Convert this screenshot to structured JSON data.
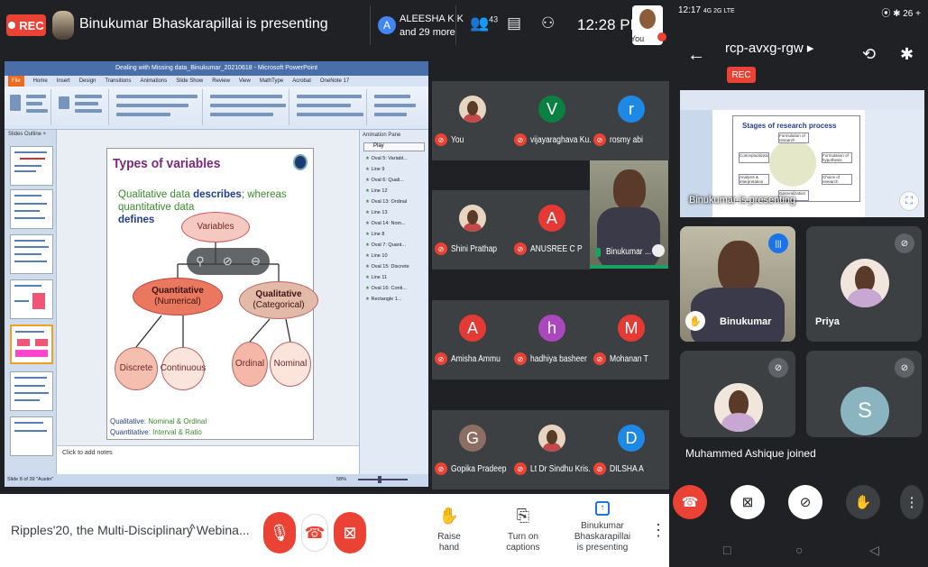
{
  "desktop": {
    "rec_label": "REC",
    "presenting_title": "Binukumar Bhaskarapillai is presenting",
    "presenter_avatar_letter": "A",
    "presenter_viewer_name": "ALEESHA K K",
    "viewer_count_text": "and 29 more",
    "people_count": "43",
    "time": "12:28 PM",
    "you_label": "You",
    "slide": {
      "app_title": "Dealing with Missing data_Binukumar_20210618 - Microsoft PowerPoint",
      "menu": [
        "File",
        "Home",
        "Insert",
        "Design",
        "Transitions",
        "Animations",
        "Slide Show",
        "Review",
        "View",
        "MathType",
        "Acrobat",
        "OneNote 17"
      ],
      "panel_tabs": "Slides   Outline   ×",
      "title": "Types of variables",
      "sub_green_1": "Qualitative data",
      "sub_blue_1": "describes",
      "sub_green_2": "; whereas quantitative data",
      "sub_blue_2": "defines",
      "node_variables": "Variables",
      "node_quant_1": "Quantitative",
      "node_quant_2": "(Numerical)",
      "node_qual_1": "Qualitative",
      "node_qual_2": "(Categorical)",
      "node_discrete": "Discrete",
      "node_continuous": "Continuous",
      "node_ordinal": "Ordinal",
      "node_nominal": "Nominal",
      "foot_1_label": "Qualitative",
      "foot_1_value": ": Nominal & Ordinal",
      "foot_2_label": "Quantitative",
      "foot_2_value": ": Interval & Ratio",
      "notes": "Click to add notes",
      "anim_header": "Animation Pane",
      "anim_play": "Play",
      "anim_items": [
        "Oval 5: Variabl...",
        "Line 9",
        "Oval 6: Quali...",
        "Line 12",
        "Oval 13: Ordinal",
        "Line 13",
        "Oval 14: Nom...",
        "Line 8",
        "Oval 7: Quant...",
        "Line 10",
        "Oval 15: Discrete",
        "Line 11",
        "Oval 16: Conti...",
        "Rectangle 1..."
      ],
      "status": "Slide 8 of 39   \"Austin\"",
      "zoom": "58%"
    },
    "tiles": [
      {
        "name": "You",
        "letter": "",
        "color": "",
        "photo": true
      },
      {
        "name": "vijayaraghava Ku...",
        "letter": "V",
        "color": "#0b8043",
        "photo": false
      },
      {
        "name": "rosmy abi",
        "letter": "r",
        "color": "#1e88e5",
        "photo": false
      },
      {
        "name": "Shini Prathap",
        "letter": "",
        "color": "",
        "photo": true
      },
      {
        "name": "ANUSREE C P",
        "letter": "A",
        "color": "#e53935",
        "photo": false
      },
      {
        "name": "Amisha Ammu",
        "letter": "A",
        "color": "#e53935",
        "photo": false
      },
      {
        "name": "hadhiya basheer",
        "letter": "h",
        "color": "#ab47bc",
        "photo": false
      },
      {
        "name": "Mohanan T",
        "letter": "M",
        "color": "#e53935",
        "photo": false
      },
      {
        "name": "Gopika Pradeep",
        "letter": "G",
        "color": "#8d6e63",
        "photo": false
      },
      {
        "name": "Lt Dr Sindhu Kris...",
        "letter": "",
        "color": "",
        "photo": true
      },
      {
        "name": "DILSHA A",
        "letter": "D",
        "color": "#1e88e5",
        "photo": false
      }
    ],
    "speaker_tile_name": "Binukumar ...",
    "bottom": {
      "meeting_name": "Ripples'20, the Multi-Disciplinary Webina...",
      "raise_hand": "Raise hand",
      "captions": "Turn on captions",
      "presenting_1": "Binukumar Bhaskarapillai",
      "presenting_2": "is presenting"
    }
  },
  "phone": {
    "status_time": "12:17",
    "status_left_extra": "4G 2G LTE",
    "status_right": "⦿ ✱ 26 +",
    "meeting_code": "rcp-avxg-rgw ▸",
    "rec_label": "REC",
    "share_slide_title": "Stages of research process",
    "share_boxes": [
      "Formulation of research problem",
      "Conceptualization",
      "Formulation of hypothesis",
      "Analysis & interpretation",
      "Choice of research design & Methodology",
      "Generalization"
    ],
    "share_caption": "Binukumar is presenting",
    "tiles": [
      {
        "name": "Binukumar"
      },
      {
        "name": "Priya"
      },
      {
        "name": ""
      },
      {
        "name": "",
        "letter": "S"
      }
    ],
    "toast": "Muhammed Ashique joined"
  }
}
